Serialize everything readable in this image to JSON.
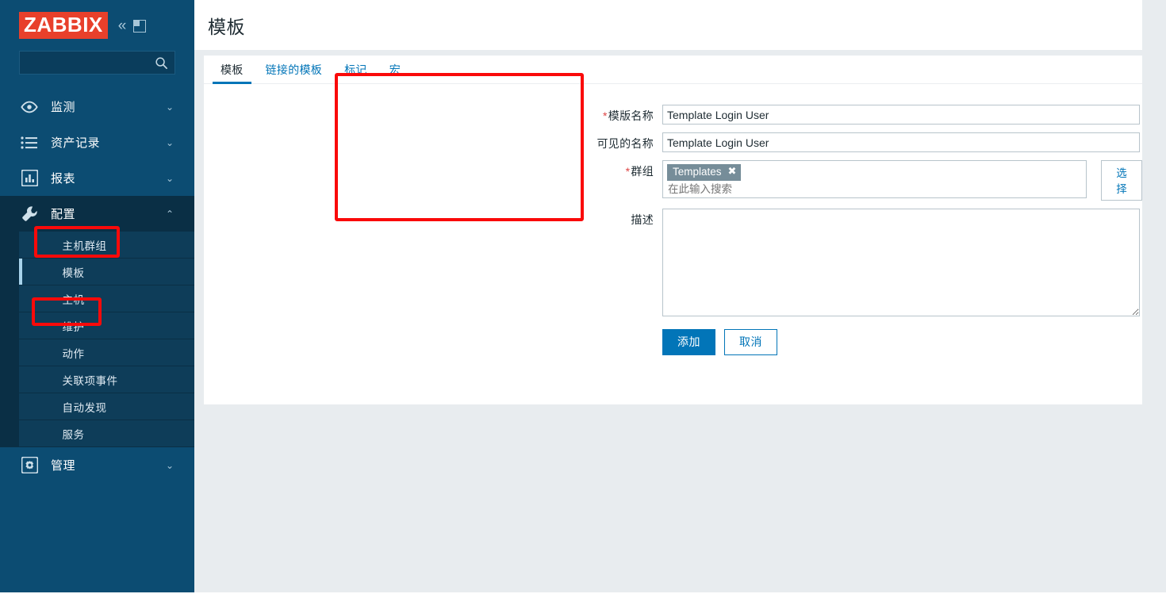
{
  "sidebar": {
    "logo": "ZABBIX",
    "collapse_icon": "chevron-double-left-icon",
    "expand_icon": "expand-panel-icon",
    "search_placeholder": "",
    "search_icon": "search-icon",
    "items": [
      {
        "label": "监测",
        "icon": "eye-icon",
        "chevron": "⌄",
        "expanded": false
      },
      {
        "label": "资产记录",
        "icon": "list-icon",
        "chevron": "⌄",
        "expanded": false
      },
      {
        "label": "报表",
        "icon": "bar-chart-icon",
        "chevron": "⌄",
        "expanded": false
      },
      {
        "label": "配置",
        "icon": "wrench-icon",
        "chevron": "⌃",
        "expanded": true
      },
      {
        "label": "管理",
        "icon": "gear-icon",
        "chevron": "⌄",
        "expanded": false
      }
    ],
    "config_submenu": [
      {
        "label": "主机群组",
        "selected": false
      },
      {
        "label": "模板",
        "selected": true
      },
      {
        "label": "主机",
        "selected": false
      },
      {
        "label": "维护",
        "selected": false
      },
      {
        "label": "动作",
        "selected": false
      },
      {
        "label": "关联项事件",
        "selected": false
      },
      {
        "label": "自动发现",
        "selected": false
      },
      {
        "label": "服务",
        "selected": false
      }
    ]
  },
  "header": {
    "title": "模板"
  },
  "tabs": [
    {
      "label": "模板",
      "active": true
    },
    {
      "label": "链接的模板",
      "active": false
    },
    {
      "label": "标记",
      "active": false
    },
    {
      "label": "宏",
      "active": false
    }
  ],
  "form": {
    "template_name": {
      "label": "模版名称",
      "required": "*",
      "value": "Template Login User"
    },
    "visible_name": {
      "label": "可见的名称",
      "required": "",
      "value": "Template Login User"
    },
    "groups": {
      "label": "群组",
      "required": "*",
      "chips": [
        {
          "label": "Templates",
          "remove_icon": "✖"
        }
      ],
      "placeholder": "在此输入搜索",
      "select_button": "选择"
    },
    "description": {
      "label": "描述",
      "required": "",
      "value": "",
      "placeholder": ""
    },
    "submit_button": "添加",
    "cancel_button": "取消"
  },
  "colors": {
    "sidebar_bg": "#0c4c72",
    "sidebar_submenu_bg": "#0e3d59",
    "sidebar_active_bg": "#0a2f45",
    "brand_red": "#e8402b",
    "accent_blue": "#0275b8",
    "annotation_red": "#fa0a0a",
    "chip_grey": "#768d99",
    "page_bg": "#e8ecef"
  },
  "annotations": [
    {
      "name": "form-highlight",
      "target": "模版名称 / 可见的名称 / 群组"
    },
    {
      "name": "config-highlight",
      "target": "配置"
    },
    {
      "name": "template-highlight",
      "target": "模板"
    }
  ]
}
